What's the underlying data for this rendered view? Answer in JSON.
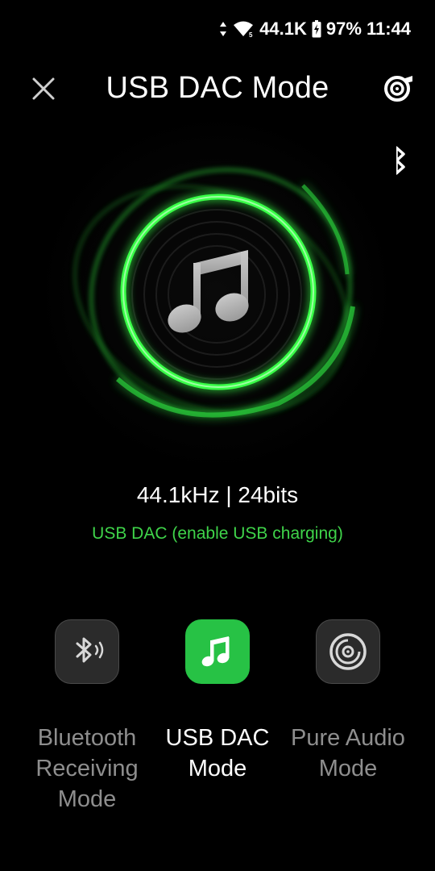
{
  "status_bar": {
    "network_speed": "44.1K",
    "battery": "97%",
    "time": "11:44",
    "icons": [
      "data-arrows-icon",
      "wifi-icon",
      "battery-charging-icon"
    ]
  },
  "header": {
    "title": "USB DAC Mode",
    "close_icon": "close-icon",
    "equalizer_icon": "equalizer-icon",
    "bluetooth_icon": "bluetooth-icon"
  },
  "hero": {
    "icon": "music-note-icon",
    "accent_color": "#2ee53c"
  },
  "playback": {
    "format": "44.1kHz | 24bits",
    "usb_status": "USB DAC (enable USB charging)",
    "usb_status_color": "#3fd44a"
  },
  "modes": [
    {
      "label_line1": "Bluetooth",
      "label_line2": "Receiving",
      "label_line3": "Mode",
      "icon": "bluetooth-receive-icon",
      "active": false
    },
    {
      "label_line1": "USB DAC",
      "label_line2": "Mode",
      "icon": "music-note-icon",
      "active": true
    },
    {
      "label_line1": "Pure Audio",
      "label_line2": "Mode",
      "icon": "disc-icon",
      "active": false
    }
  ]
}
